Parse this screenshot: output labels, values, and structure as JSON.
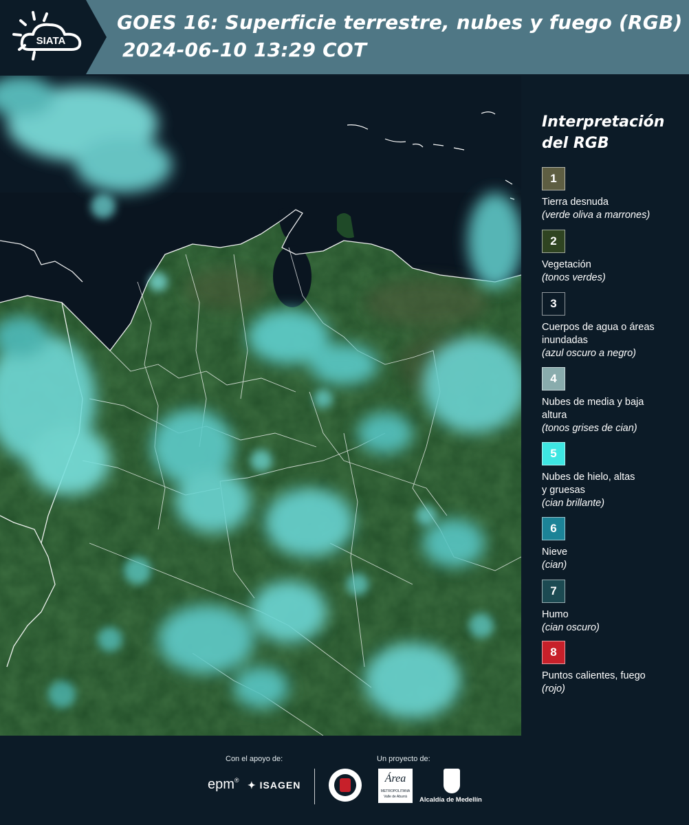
{
  "header": {
    "logo_text": "SIATA",
    "title_line1": "GOES 16: Superficie terrestre, nubes y fuego (RGB)",
    "title_line2": "2024-06-10 13:29 COT",
    "colors": {
      "header_bg": "#4f7785",
      "logo_bg": "#0c1b27"
    }
  },
  "legend": {
    "title": "Interpretación del RGB",
    "items": [
      {
        "number": "1",
        "label": "Tierra desnuda",
        "desc": "(verde oliva a marrones)",
        "color": "#5e5e42"
      },
      {
        "number": "2",
        "label": "Vegetación",
        "desc": "(tonos verdes)",
        "color": "#2f4421"
      },
      {
        "number": "3",
        "label": "Cuerpos de agua o áreas inundadas",
        "desc": "(azul oscuro a negro)",
        "color": "#0c1b27"
      },
      {
        "number": "4",
        "label": "Nubes de media y baja altura",
        "desc": "(tonos grises de cian)",
        "color": "#89acad"
      },
      {
        "number": "5",
        "label": "Nubes de hielo, altas y gruesas",
        "desc": "(cian brillante)",
        "color": "#3ee6e2"
      },
      {
        "number": "6",
        "label": "Nieve",
        "desc": "(cian)",
        "color": "#1c8397"
      },
      {
        "number": "7",
        "label": "Humo",
        "desc": "(cian oscuro)",
        "color": "#1c4a52"
      },
      {
        "number": "8",
        "label": "Puntos calientes, fuego",
        "desc": "(rojo)",
        "color": "#c7202a"
      }
    ]
  },
  "footer": {
    "support_label": "Con el apoyo de:",
    "project_label": "Un proyecto de:",
    "sponsors": {
      "epm": "epm",
      "isagen": "ISAGEN",
      "area_top": "Área",
      "area_sub": "METROPOLITANA",
      "area_sub2": "Valle de Aburrá",
      "alcaldia": "Alcaldía de Medellín"
    }
  }
}
